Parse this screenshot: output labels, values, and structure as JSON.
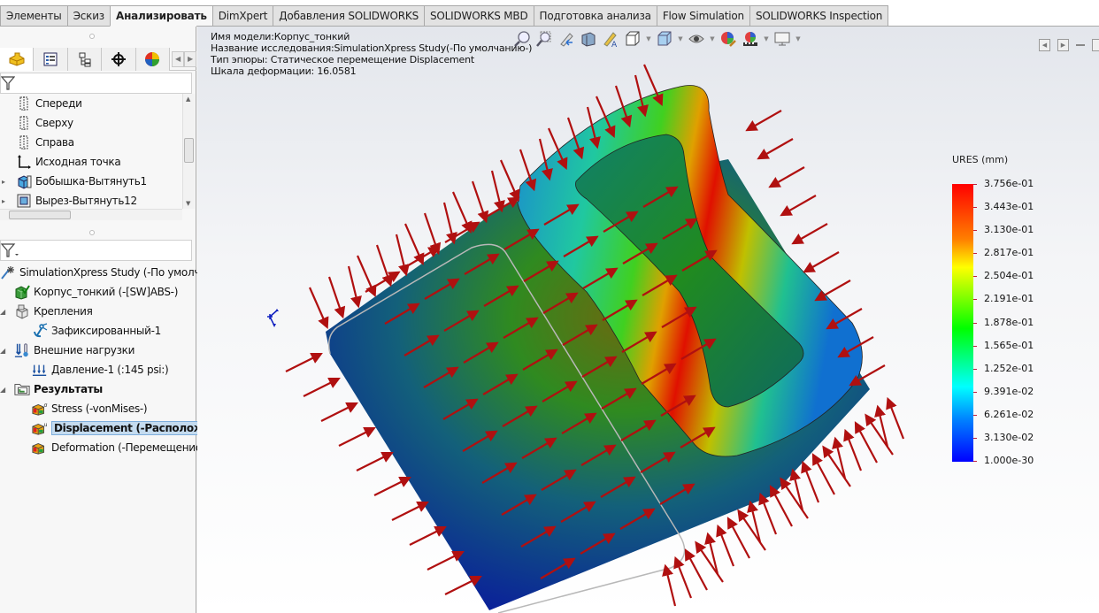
{
  "command_tabs": [
    {
      "label": "Элементы",
      "active": false
    },
    {
      "label": "Эскиз",
      "active": false
    },
    {
      "label": "Анализировать",
      "active": true
    },
    {
      "label": "DimXpert",
      "active": false
    },
    {
      "label": "Добавления SOLIDWORKS",
      "active": false
    },
    {
      "label": "SOLIDWORKS MBD",
      "active": false
    },
    {
      "label": "Подготовка анализа",
      "active": false
    },
    {
      "label": "Flow Simulation",
      "active": false
    },
    {
      "label": "SOLIDWORKS Inspection",
      "active": false
    }
  ],
  "manager_tabs": [
    {
      "icon": "feature-manager-icon",
      "active": true
    },
    {
      "icon": "property-manager-icon",
      "active": false
    },
    {
      "icon": "configuration-manager-icon",
      "active": false
    },
    {
      "icon": "dimxpert-manager-icon",
      "active": false
    },
    {
      "icon": "display-manager-icon",
      "active": false
    }
  ],
  "feature_tree": {
    "items": [
      {
        "label": "Спереди",
        "icon": "plane-icon",
        "expandable": false
      },
      {
        "label": "Сверху",
        "icon": "plane-icon",
        "expandable": false
      },
      {
        "label": "Справа",
        "icon": "plane-icon",
        "expandable": false
      },
      {
        "label": "Исходная точка",
        "icon": "origin-icon",
        "expandable": false
      },
      {
        "label": "Бобышка-Вытянуть1",
        "icon": "boss-extrude-icon",
        "expandable": true
      },
      {
        "label": "Вырез-Вытянуть12",
        "icon": "cut-extrude-icon",
        "expandable": true
      }
    ]
  },
  "simulation_tree": {
    "study": "SimulationXpress Study (-По умолчан",
    "items": [
      {
        "label": "Корпус_тонкий (-[SW]ABS-)",
        "icon": "part-material-icon",
        "level": 1,
        "expandable": false
      },
      {
        "label": "Крепления",
        "icon": "fixtures-icon",
        "level": 1,
        "expandable": true
      },
      {
        "label": "Зафиксированный-1",
        "icon": "fixed-anchor-icon",
        "level": 2,
        "expandable": false
      },
      {
        "label": "Внешние нагрузки",
        "icon": "external-loads-icon",
        "level": 1,
        "expandable": true
      },
      {
        "label": "Давление-1 (:145 psi:)",
        "icon": "pressure-icon",
        "level": 2,
        "expandable": false
      },
      {
        "label": "Результаты",
        "icon": "results-folder-icon",
        "level": 1,
        "expandable": true,
        "bold": true
      },
      {
        "label": "Stress (-vonMises-)",
        "icon": "stress-plot-icon",
        "level": 2,
        "expandable": false
      },
      {
        "label": "Displacement (-Расположен",
        "icon": "displacement-plot-icon",
        "level": 2,
        "expandable": false,
        "selected": true
      },
      {
        "label": "Deformation (-Перемещение",
        "icon": "deformation-plot-icon",
        "level": 2,
        "expandable": false
      }
    ]
  },
  "plot_info": {
    "model_name": "Имя модели:Корпус_тонкий",
    "study_name": "Название исследования:SimulationXpress Study(-По умолчанию-)",
    "plot_type": "Тип эпюры: Статическое перемещение Displacement",
    "deformation_scale": "Шкала деформации: 16.0581"
  },
  "heads_up_toolbar": [
    "zoom-to-fit-icon",
    "zoom-to-area-icon",
    "previous-view-icon",
    "section-view-icon",
    "dynamic-annotation-icon",
    "view-orientation-icon",
    "display-style-icon",
    "hide-show-items-icon",
    "edit-appearance-icon",
    "apply-scene-icon",
    "view-settings-icon"
  ],
  "legend": {
    "title": "URES (mm)",
    "values": [
      "3.756e-01",
      "3.443e-01",
      "3.130e-01",
      "2.817e-01",
      "2.504e-01",
      "2.191e-01",
      "1.878e-01",
      "1.565e-01",
      "1.252e-01",
      "9.391e-02",
      "6.261e-02",
      "3.130e-02",
      "1.000e-30"
    ],
    "max_color": "#ff0000",
    "min_color": "#0000ff"
  },
  "colors": {
    "selection_bg": "#c4dbef",
    "arrow_color": "#b01010"
  }
}
